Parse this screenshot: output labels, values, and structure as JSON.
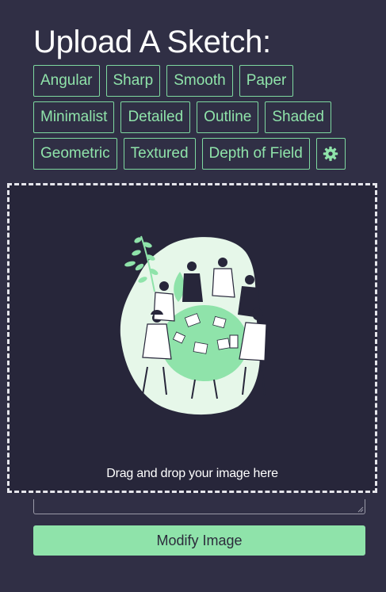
{
  "header": {
    "title": "Upload A Sketch:"
  },
  "style_tags": {
    "row1": [
      "Angular",
      "Sharp",
      "Smooth",
      "Paper"
    ],
    "row2": [
      "Minimalist",
      "Detailed",
      "Outline",
      "Shaded"
    ],
    "row3": [
      "Geometric",
      "Textured",
      "Depth of Field"
    ],
    "settings_icon": "gear-icon"
  },
  "dropzone": {
    "label": "Drag and drop your image here",
    "preview_image": "team-meeting-illustration"
  },
  "prompt_input": {
    "value": ""
  },
  "actions": {
    "modify_label": "Modify Image"
  },
  "colors": {
    "background": "#302f45",
    "accent": "#8fe3aa",
    "dropzone_bg": "#27263a"
  }
}
